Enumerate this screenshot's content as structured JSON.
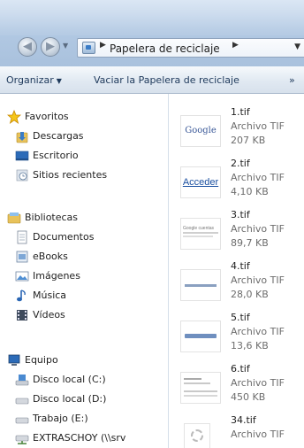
{
  "window": {
    "breadcrumb": "Papelera de reciclaje"
  },
  "toolbar": {
    "organize_label": "Organizar",
    "empty_label": "Vaciar la Papelera de reciclaje",
    "more_label": "»"
  },
  "nav": {
    "favorites": {
      "label": "Favoritos",
      "icon": "star-icon"
    },
    "downloads": {
      "label": "Descargas",
      "icon": "downloads-icon"
    },
    "desktop": {
      "label": "Escritorio",
      "icon": "desktop-icon"
    },
    "recent": {
      "label": "Sitios recientes",
      "icon": "recent-places-icon"
    },
    "libraries": {
      "label": "Bibliotecas",
      "icon": "libraries-icon"
    },
    "documents": {
      "label": "Documentos",
      "icon": "documents-icon"
    },
    "ebooks": {
      "label": "eBooks",
      "icon": "ebooks-icon"
    },
    "images": {
      "label": "Imágenes",
      "icon": "pictures-icon"
    },
    "music": {
      "label": "Música",
      "icon": "music-icon"
    },
    "videos": {
      "label": "Vídeos",
      "icon": "videos-icon"
    },
    "computer": {
      "label": "Equipo",
      "icon": "computer-icon"
    },
    "disk_c": {
      "label": "Disco local (C:)",
      "icon": "system-drive-icon"
    },
    "disk_d": {
      "label": "Disco local (D:)",
      "icon": "drive-icon"
    },
    "work_e": {
      "label": "Trabajo (E:)",
      "icon": "drive-icon"
    },
    "network": {
      "label": "EXTRASCHOY (\\\\srv",
      "icon": "network-drive-icon"
    }
  },
  "files": [
    {
      "name": "1.tif",
      "type": "Archivo TIF",
      "size": "207 KB",
      "thumb_text": "Google"
    },
    {
      "name": "2.tif",
      "type": "Archivo TIF",
      "size": "4,10 KB",
      "thumb_text": "Acceder"
    },
    {
      "name": "3.tif",
      "type": "Archivo TIF",
      "size": "89,7 KB",
      "thumb_text": "Google cuentas"
    },
    {
      "name": "4.tif",
      "type": "Archivo TIF",
      "size": "28,0 KB",
      "thumb_text": ""
    },
    {
      "name": "5.tif",
      "type": "Archivo TIF",
      "size": "13,6 KB",
      "thumb_text": ""
    },
    {
      "name": "6.tif",
      "type": "Archivo TIF",
      "size": "450 KB",
      "thumb_text": ""
    },
    {
      "name": "34.tif",
      "type": "Archivo TIF",
      "size": "",
      "thumb_text": ""
    }
  ]
}
